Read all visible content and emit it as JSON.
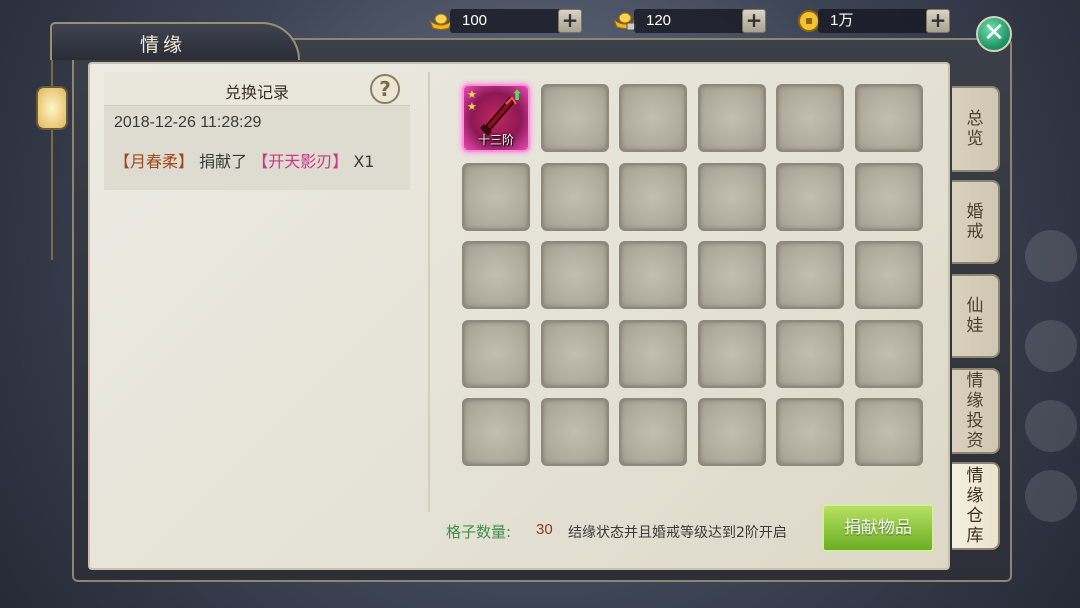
{
  "window": {
    "title": "情缘"
  },
  "currency": [
    {
      "icon": "gold-ingot-icon",
      "value": "100"
    },
    {
      "icon": "locked-gold-ingot-icon",
      "value": "120"
    },
    {
      "icon": "coin-icon",
      "value": "1万"
    }
  ],
  "record": {
    "title": "兑换记录",
    "help": "?",
    "time": "2018-12-26  11:28:29",
    "player": "【月春柔】",
    "action": "捐献了",
    "item": "【开天影刃】",
    "count": "X1"
  },
  "grid": {
    "total_slots": 30,
    "item": {
      "name": "开天影刃",
      "tier": "十三阶",
      "stars": 2
    }
  },
  "info": {
    "label": "格子数量:",
    "count": "30",
    "note": "结缘状态并且婚戒等级达到2阶开启"
  },
  "donate_label": "捐献物品",
  "tabs": [
    {
      "label": "总览"
    },
    {
      "label": "婚戒"
    },
    {
      "label": "仙娃"
    },
    {
      "label": "情缘投资"
    },
    {
      "label": "情缘仓库",
      "active": true
    }
  ],
  "colors": {
    "donate": "#6bae24",
    "item_name": "#d2348a",
    "player_name": "#a04a1c",
    "count_label": "#3f8f4a"
  }
}
